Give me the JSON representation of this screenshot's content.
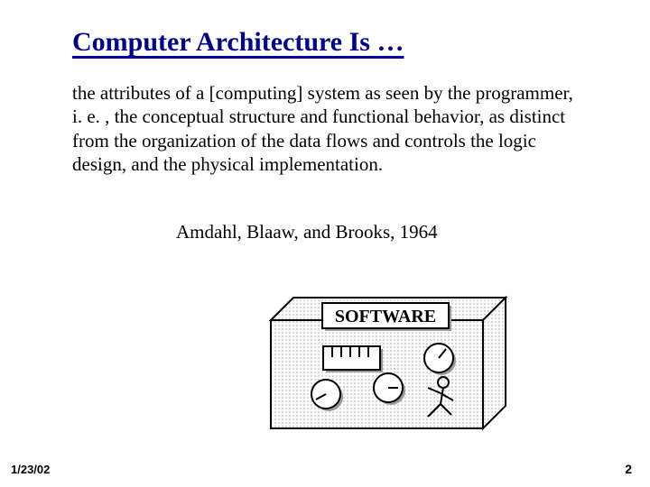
{
  "title": "Computer Architecture Is …",
  "body": "the attributes of a [computing] system as seen by the programmer, i. e. , the conceptual structure and functional behavior, as distinct from the organization of the data flows and controls the logic design, and the physical implementation.",
  "attribution": "Amdahl, Blaaw, and Brooks,  1964",
  "diagram_label": "SOFTWARE",
  "footer": {
    "date": "1/23/02",
    "page": "2"
  }
}
